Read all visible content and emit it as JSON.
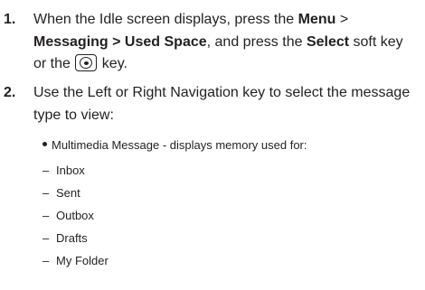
{
  "steps": [
    {
      "number": "1.",
      "line1": {
        "pre": "When the Idle screen displays, press the ",
        "menu": "Menu",
        "post": " >"
      },
      "line2": {
        "path": "Messaging > Used Space",
        "mid": ", and press the ",
        "select": "Select",
        "post": " soft key"
      },
      "line3": {
        "pre": "or the ",
        "post": " key."
      },
      "key_icon": "ok-key-icon"
    },
    {
      "number": "2.",
      "line1": "Use the Left or Right Navigation key to select the message",
      "line2": "type to view:"
    }
  ],
  "bullet": {
    "dash": "–",
    "text": "Multimedia Message - displays memory used for:",
    "items": [
      "Inbox",
      "Sent",
      "Outbox",
      "Drafts",
      "My Folder"
    ]
  }
}
